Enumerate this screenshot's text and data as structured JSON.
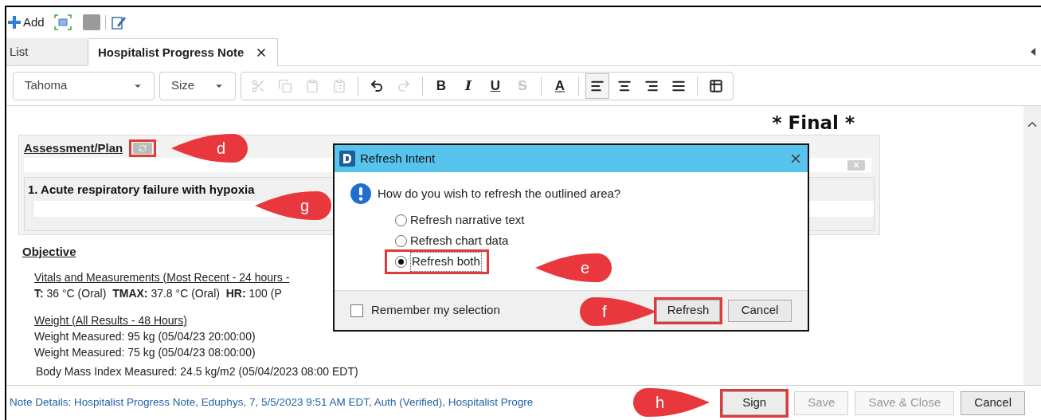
{
  "toolbar": {
    "add_label": "Add"
  },
  "tabs": [
    {
      "label": "List",
      "selected": false,
      "closable": false
    },
    {
      "label": "Hospitalist Progress Note",
      "selected": true,
      "closable": true
    }
  ],
  "format_toolbar": {
    "font": "Tahoma",
    "size": "Size",
    "buttons": [
      {
        "kind": "icon",
        "disabled": true,
        "selected": false
      },
      {
        "kind": "icon",
        "disabled": true,
        "selected": false
      },
      {
        "kind": "icon",
        "disabled": true,
        "selected": false
      },
      {
        "kind": "icon",
        "disabled": true,
        "selected": false
      },
      {
        "kind": "separator"
      },
      {
        "kind": "icon",
        "disabled": false,
        "selected": false
      },
      {
        "kind": "icon",
        "disabled": true,
        "selected": false
      },
      {
        "kind": "separator"
      },
      {
        "kind": "text",
        "label": "B",
        "disabled": false,
        "selected": false
      },
      {
        "kind": "text",
        "label": "I",
        "disabled": false,
        "selected": false
      },
      {
        "kind": "text",
        "label": "U",
        "disabled": false,
        "selected": false
      },
      {
        "kind": "text",
        "label": "S",
        "disabled": true,
        "selected": false
      },
      {
        "kind": "separator"
      },
      {
        "kind": "text",
        "label": "A",
        "disabled": false,
        "selected": false
      },
      {
        "kind": "separator"
      },
      {
        "kind": "icon",
        "disabled": false,
        "selected": true
      },
      {
        "kind": "icon",
        "disabled": false,
        "selected": false
      },
      {
        "kind": "icon",
        "disabled": false,
        "selected": false
      },
      {
        "kind": "icon",
        "disabled": false,
        "selected": false
      },
      {
        "kind": "separator"
      },
      {
        "kind": "icon",
        "disabled": false,
        "selected": false
      }
    ]
  },
  "document": {
    "status": "* Final *",
    "assessment": {
      "title": "Assessment/Plan",
      "refresh_highlighted": true,
      "problems": [
        "1. Acute respiratory failure with hypoxia"
      ]
    },
    "objective": {
      "title": "Objective",
      "groups": [
        {
          "heading": "Vitals and Measurements (Most Recent - 24 hours -",
          "lines": [
            "**T:** 36 °C (Oral)  **TMAX:** 37.8 °C (Oral)  **HR:** 100 (P"
          ]
        },
        {
          "heading": "Weight (All Results - 48 Hours)",
          "lines": [
            "Weight Measured: 95 kg (05/04/23 20:00:00)",
            "Weight Measured: 75 kg (05/04/23 08:00:00)",
            "Body Mass Index Measured: 24.5 kg/m2 (05/04/2023 08:00 EDT)"
          ]
        }
      ]
    }
  },
  "dialog": {
    "title": "Refresh Intent",
    "question": "How do you wish to refresh the outlined area?",
    "options": [
      {
        "label": "Refresh narrative text",
        "selected": false,
        "highlighted": false
      },
      {
        "label": "Refresh chart data",
        "selected": false,
        "highlighted": false
      },
      {
        "label": "Refresh both",
        "selected": true,
        "highlighted": true
      }
    ],
    "remember": {
      "label": "Remember my selection",
      "checked": false
    },
    "buttons": [
      {
        "label": "Refresh",
        "highlighted": true
      },
      {
        "label": "Cancel",
        "highlighted": false
      }
    ]
  },
  "footer": {
    "note_details": "Note Details: Hospitalist Progress Note, Eduphys, 7, 5/5/2023 9:51 AM EDT, Auth (Verified), Hospitalist Progre",
    "buttons": [
      {
        "label": "Sign",
        "disabled": false,
        "highlighted": true
      },
      {
        "label": "Save",
        "disabled": true,
        "highlighted": false
      },
      {
        "label": "Save & Close",
        "disabled": true,
        "highlighted": false
      },
      {
        "label": "Cancel",
        "disabled": false,
        "highlighted": false
      }
    ]
  },
  "callouts": [
    {
      "letter": "d"
    },
    {
      "letter": "g"
    },
    {
      "letter": "e"
    },
    {
      "letter": "f"
    },
    {
      "letter": "h"
    }
  ]
}
